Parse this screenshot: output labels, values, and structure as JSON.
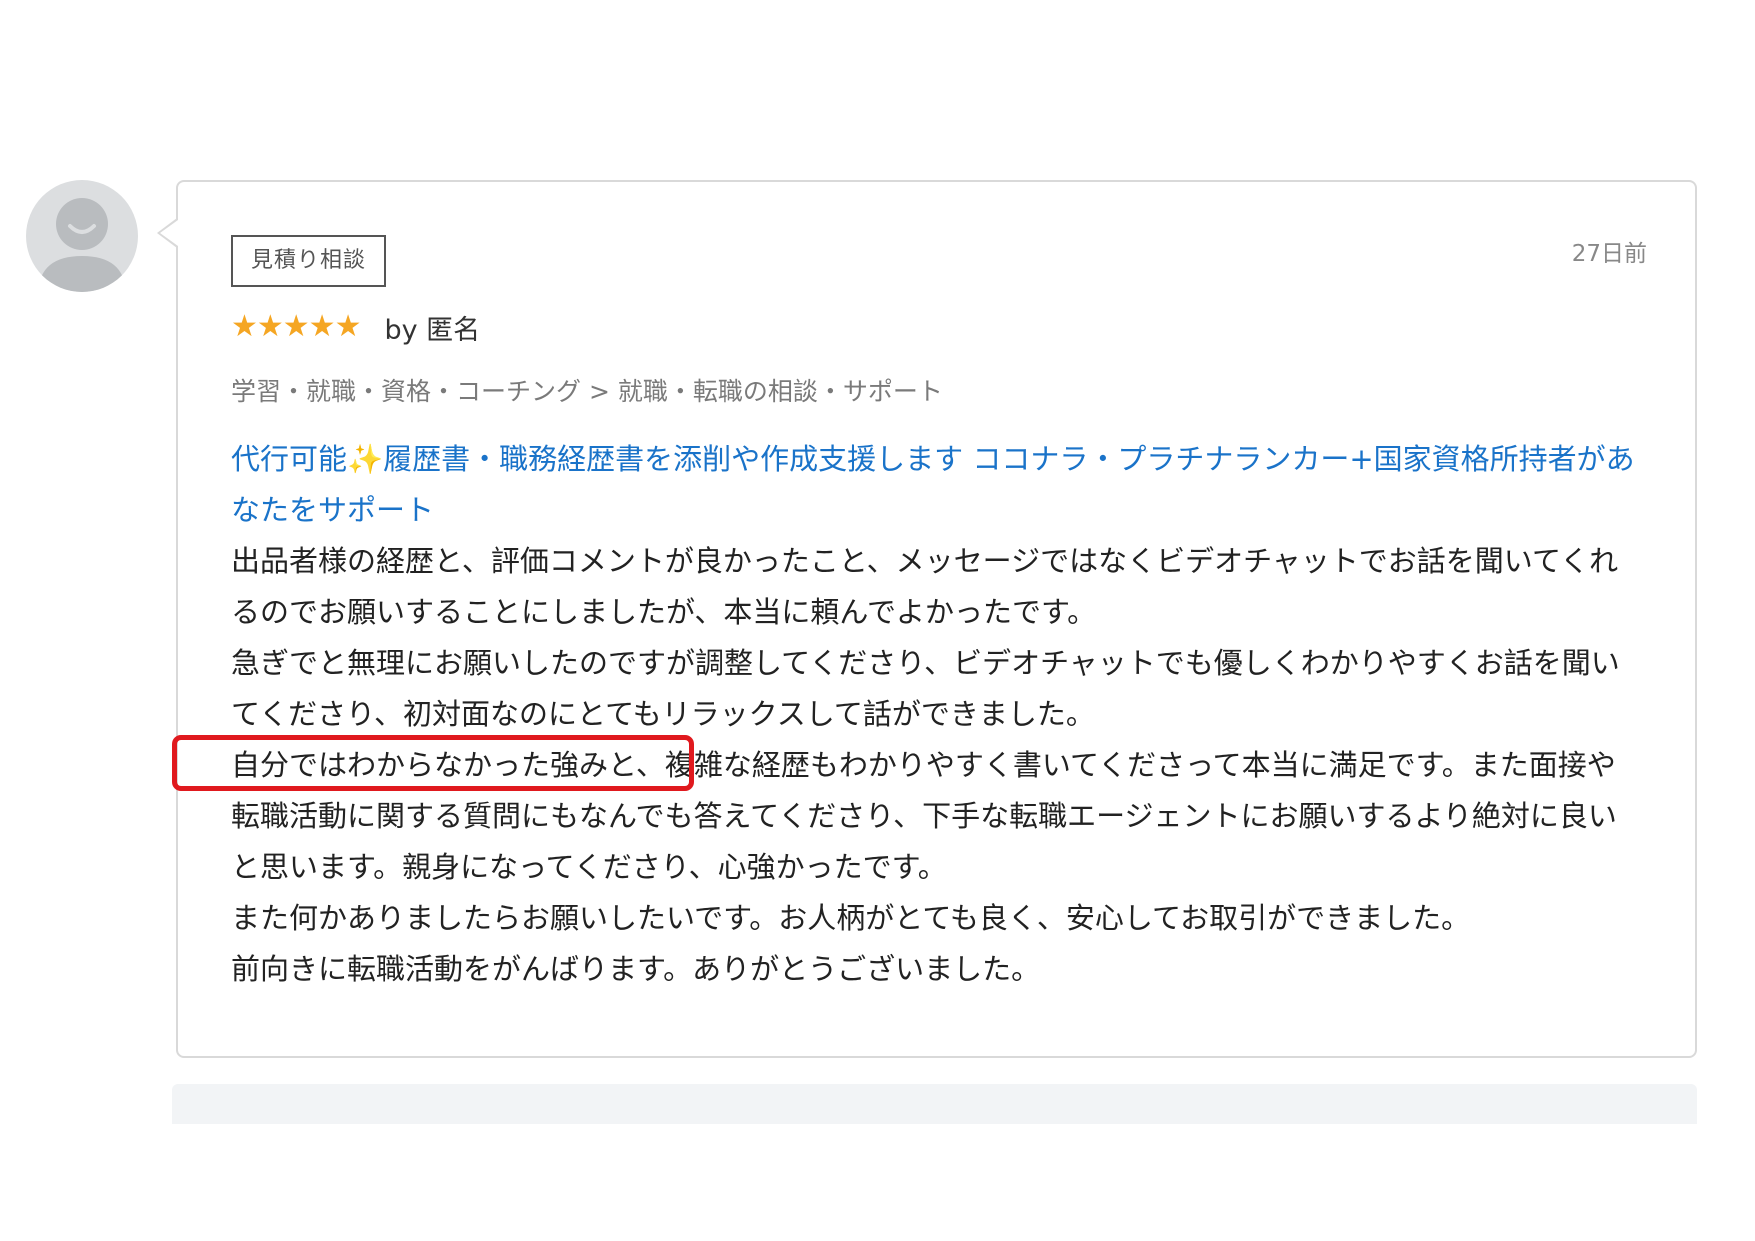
{
  "review": {
    "tag": "見積り相談",
    "date": "27日前",
    "stars": "★★★★★",
    "rating": 5,
    "reviewer": "by 匿名",
    "breadcrumb": "学習・就職・資格・コーチング > 就職・転職の相談・サポート",
    "service_title_prefix": "代行可能",
    "service_title_sparkle": "✨",
    "service_title_rest": "履歴書・職務経歴書を添削や作成支援します ココナラ・プラチナランカー+国家資格所持者があなたをサポート",
    "body": [
      "出品者様の経歴と、評価コメントが良かったこと、メッセージではなくビデオチャットでお話を聞いてくれるのでお願いすることにしましたが、本当に頼んでよかったです。",
      "急ぎでと無理にお願いしたのですが調整してくださり、ビデオチャットでも優しくわかりやすくお話を聞いてくださり、初対面なのにとてもリラックスして話ができました。",
      "自分ではわからなかった強みと、複雑な経歴もわかりやすく書いてくださって本当に満足です。また面接や転職活動に関する質問にもなんでも答えてくださり、下手な転職エージェントにお願いするより絶対に良いと思います。親身になってくださり、心強かったです。",
      "また何かありましたらお願いしたいです。お人柄がとても良く、安心してお取引ができました。",
      "前向きに転職活動をがんばります。ありがとうございました。"
    ]
  },
  "colors": {
    "star": "#f5a623",
    "link": "#1a73c9",
    "highlight": "#e0191e",
    "border": "#d9d9d9"
  },
  "icons": {
    "avatar": "default-user-avatar-icon"
  }
}
